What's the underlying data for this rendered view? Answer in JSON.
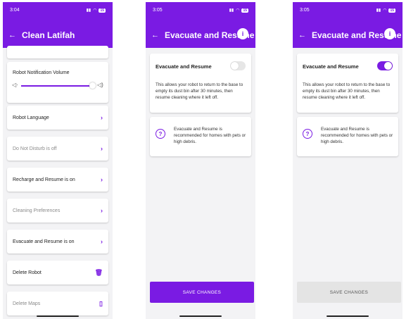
{
  "screen1": {
    "status": {
      "time": "3:04",
      "battery": "15"
    },
    "title": "Clean Latifah",
    "volume_label": "Robot Notification Volume",
    "volume_level_percent": 88,
    "items": [
      {
        "label": "Robot Language"
      },
      {
        "label": "Do Not Disturb is off"
      },
      {
        "label": "Recharge and Resume is on"
      },
      {
        "label": "Cleaning Preferences"
      },
      {
        "label": "Evacuate and Resume is on"
      },
      {
        "label": "Delete Robot"
      },
      {
        "label": "Delete Maps"
      }
    ]
  },
  "screen2": {
    "status": {
      "time": "3:05",
      "battery": "15"
    },
    "title": "Evacuate and Resume",
    "info_label": "i",
    "setting_title": "Evacuate and Resume",
    "toggle_on": false,
    "description": "This allows your robot to return to the base to empty its dust bin after 30 minutes, then resume cleaning where it left off.",
    "note": "Evacuate and Resume is recommended for homes with pets or high debris.",
    "save_label": "SAVE CHANGES"
  },
  "screen3": {
    "status": {
      "time": "3:05",
      "battery": "15"
    },
    "title": "Evacuate and Resume",
    "info_label": "i",
    "setting_title": "Evacuate and Resume",
    "toggle_on": true,
    "description": "This allows your robot to return to the base to empty its dust bin after 30 minutes, then resume cleaning where it left off.",
    "note": "Evacuate and Resume is recommended for homes with pets or high debris.",
    "save_label": "SAVE CHANGES"
  },
  "colors": {
    "accent": "#7a1be3",
    "background": "#f3f3f5"
  },
  "icons": [
    "back-arrow-icon",
    "info-icon",
    "chevron-right-icon",
    "trash-icon",
    "maps-icon",
    "question-icon",
    "speaker-low-icon",
    "speaker-high-icon"
  ]
}
